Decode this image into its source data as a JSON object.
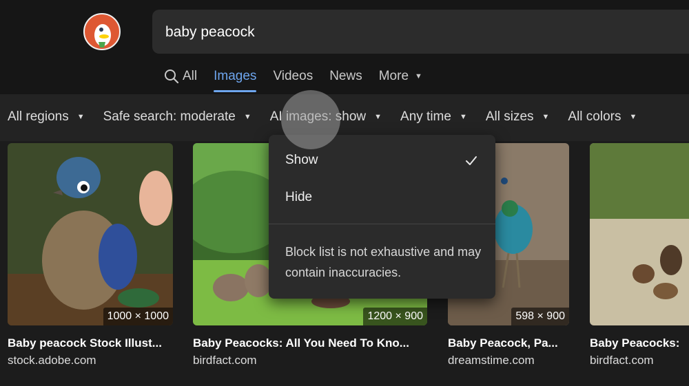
{
  "search": {
    "query": "baby peacock"
  },
  "nav": {
    "all": "All",
    "images": "Images",
    "videos": "Videos",
    "news": "News",
    "more": "More"
  },
  "filters": {
    "regions": "All regions",
    "safe_search": "Safe search: moderate",
    "ai_images": "AI images: show",
    "time": "Any time",
    "sizes": "All sizes",
    "colors": "All colors"
  },
  "dropdown": {
    "show": "Show",
    "hide": "Hide",
    "note": "Block list is not exhaustive and may contain inaccuracies."
  },
  "results": [
    {
      "title": "Baby peacock Stock Illust...",
      "source": "stock.adobe.com",
      "dims": "1000 × 1000"
    },
    {
      "title": "Baby Peacocks: All You Need To Kno...",
      "source": "birdfact.com",
      "dims": "1200 × 900"
    },
    {
      "title": "Baby Peacock, Pa...",
      "source": "dreamstime.com",
      "dims": "598 × 900"
    },
    {
      "title": "Baby Peacocks:",
      "source": "birdfact.com",
      "dims": ""
    }
  ],
  "colors": {
    "accent": "#6ea6ef",
    "logo": "#de5833"
  },
  "icons": [
    "duckduckgo-logo",
    "search-icon",
    "checkmark-icon"
  ]
}
